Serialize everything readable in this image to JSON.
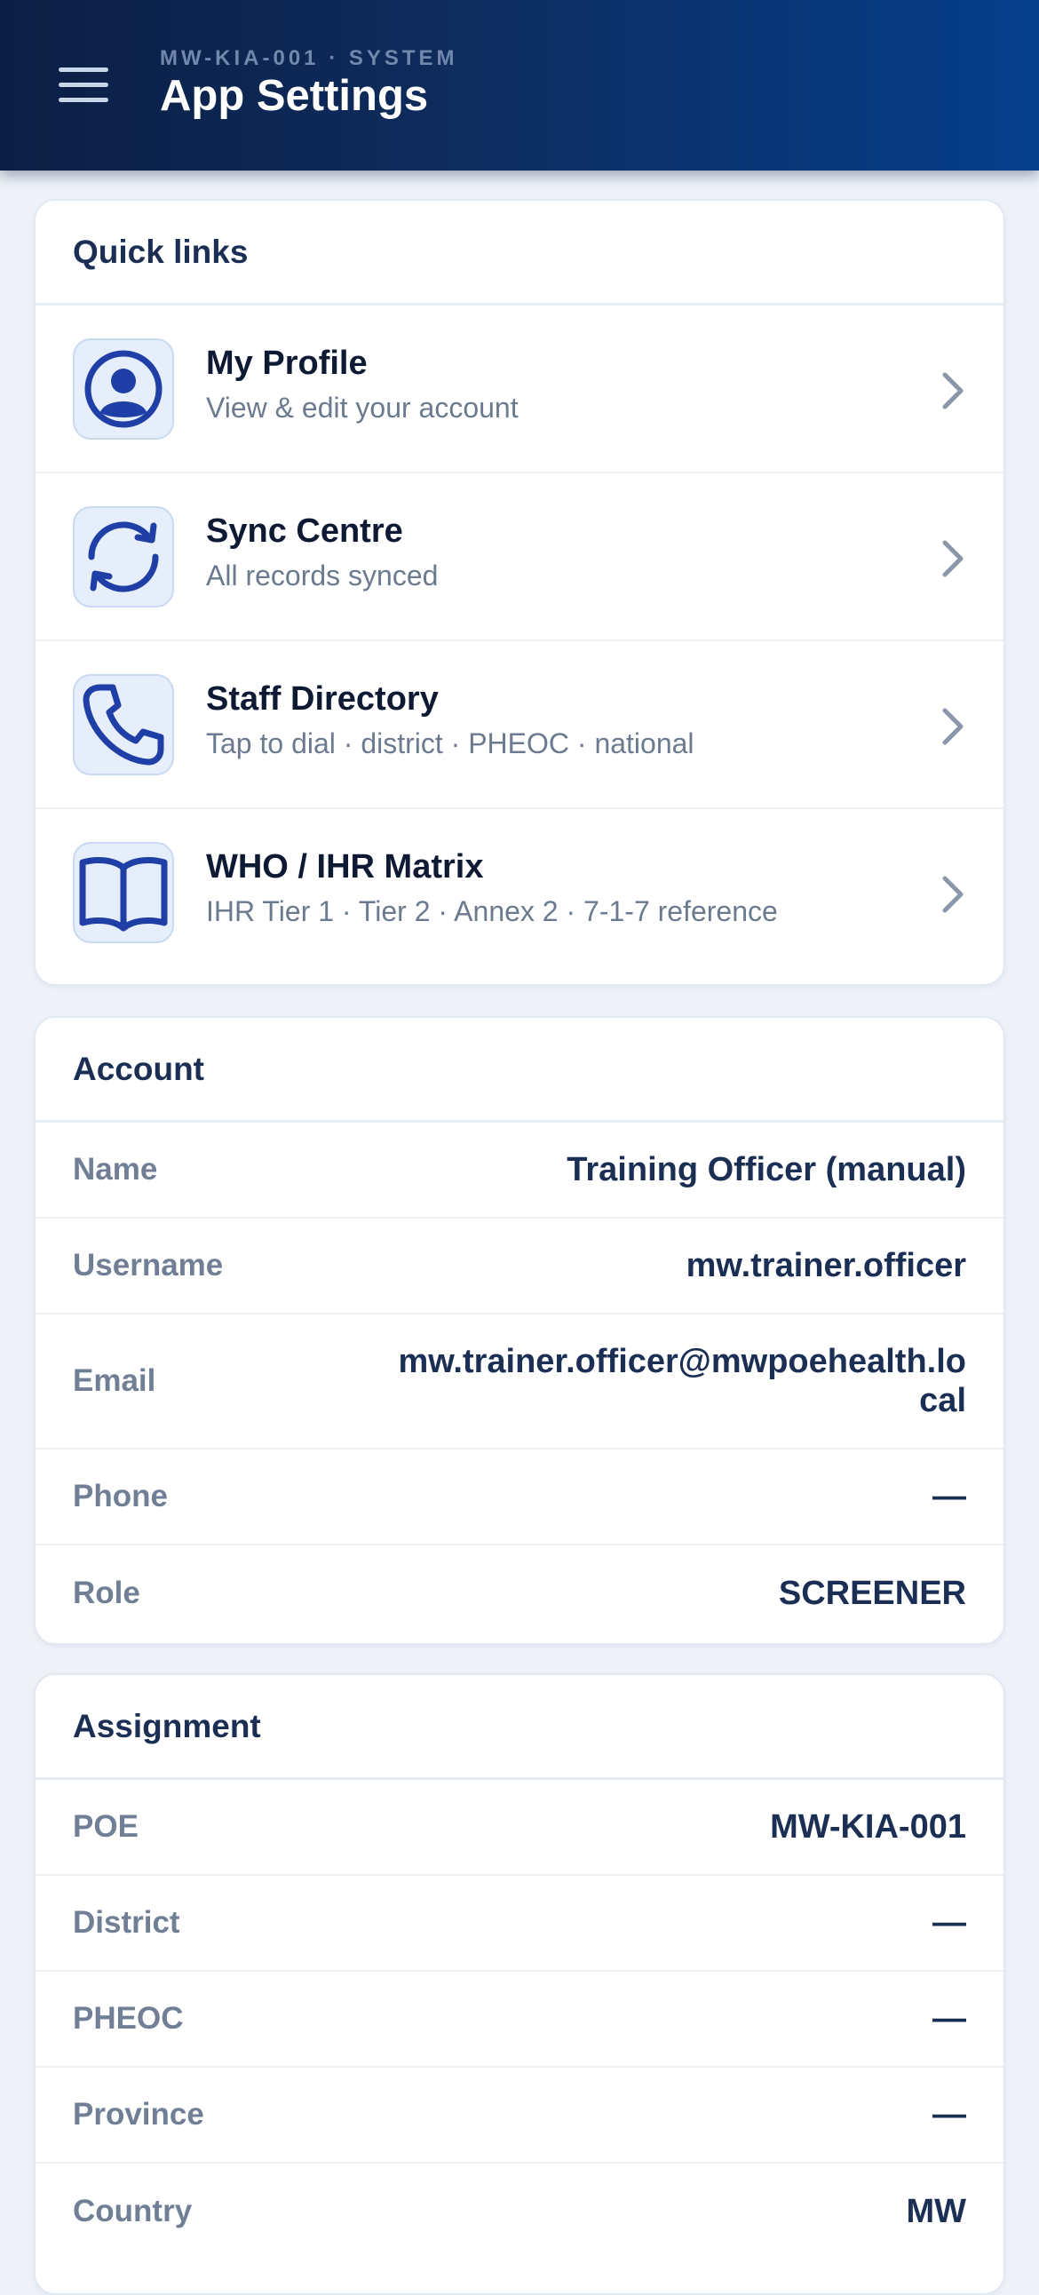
{
  "header": {
    "eyebrow": "MW-KIA-001 · SYSTEM",
    "title": "App Settings",
    "menu_icon": "hamburger-menu-icon"
  },
  "quick_links": {
    "title": "Quick links",
    "items": [
      {
        "title": "My Profile",
        "subtitle": "View & edit your account",
        "icon": "user-circle-icon"
      },
      {
        "title": "Sync Centre",
        "subtitle": "All records synced",
        "icon": "sync-icon"
      },
      {
        "title": "Staff Directory",
        "subtitle": "Tap to dial · district · PHEOC · national",
        "icon": "phone-icon"
      },
      {
        "title": "WHO / IHR Matrix",
        "subtitle": "IHR Tier 1 · Tier 2 · Annex 2 · 7-1-7 reference",
        "icon": "book-icon"
      }
    ]
  },
  "account": {
    "title": "Account",
    "rows": [
      {
        "label": "Name",
        "value": "Training Officer (manual)"
      },
      {
        "label": "Username",
        "value": "mw.trainer.officer"
      },
      {
        "label": "Email",
        "value": "mw.trainer.officer@mwpoehealth.local"
      },
      {
        "label": "Phone",
        "value": "—"
      },
      {
        "label": "Role",
        "value": "SCREENER"
      }
    ]
  },
  "assignment": {
    "title": "Assignment",
    "rows": [
      {
        "label": "POE",
        "value": "MW-KIA-001"
      },
      {
        "label": "District",
        "value": "—"
      },
      {
        "label": "PHEOC",
        "value": "—"
      },
      {
        "label": "Province",
        "value": "—"
      },
      {
        "label": "Country",
        "value": "MW"
      }
    ]
  },
  "colors": {
    "header_start": "#0b1f44",
    "header_end": "#053f8c",
    "icon_accent": "#1f3fa6",
    "heading": "#1b2f55",
    "muted": "#707f95"
  }
}
